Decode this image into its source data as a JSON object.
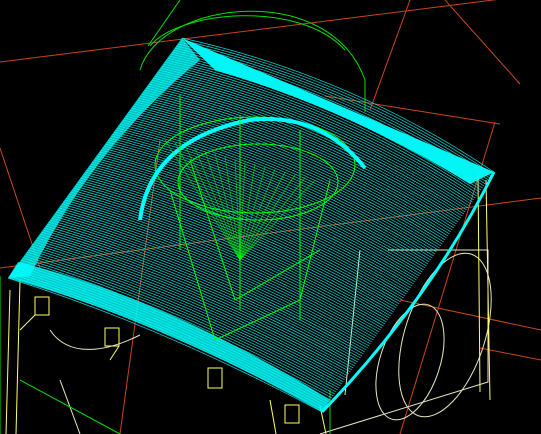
{
  "viewport": {
    "background": "#000000",
    "colors": {
      "toolpath": "#00ffff",
      "part_wireframe": "#00ff00",
      "fixture_wireframe": "#ffff66",
      "grid": "#cc4a1a",
      "fixture_dim": "#e8e8c0"
    }
  }
}
